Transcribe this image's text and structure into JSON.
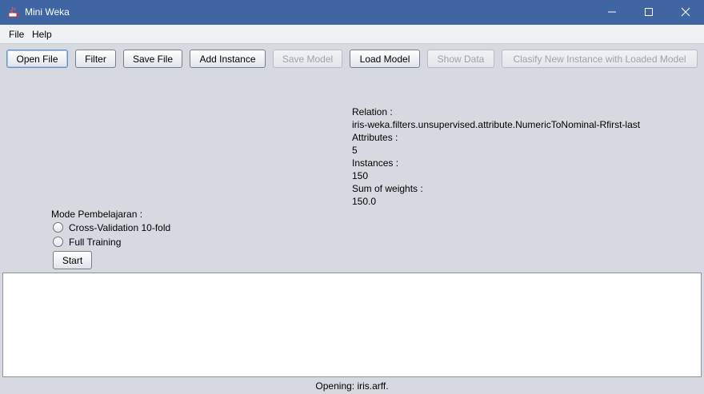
{
  "window": {
    "title": "Mini Weka"
  },
  "menu": [
    "File",
    "Help"
  ],
  "toolbar": {
    "open_file": "Open File",
    "filter": "Filter",
    "save_file": "Save File",
    "add_instance": "Add Instance",
    "save_model": "Save Model",
    "load_model": "Load Model",
    "show_data": "Show Data",
    "classify": "Clasify New Instance with Loaded Model"
  },
  "dataset": {
    "relation_label": "Relation :",
    "relation_value": "iris-weka.filters.unsupervised.attribute.NumericToNominal-Rfirst-last",
    "attributes_label": "Attributes :",
    "attributes_value": "5",
    "instances_label": "Instances :",
    "instances_value": "150",
    "weights_label": "Sum of weights :",
    "weights_value": "150.0"
  },
  "learning": {
    "mode_label": "Mode Pembelajaran :",
    "options": [
      "Cross-Validation 10-fold",
      "Full Training"
    ],
    "start_label": "Start"
  },
  "output_text": "",
  "status": "Opening: iris.arff."
}
